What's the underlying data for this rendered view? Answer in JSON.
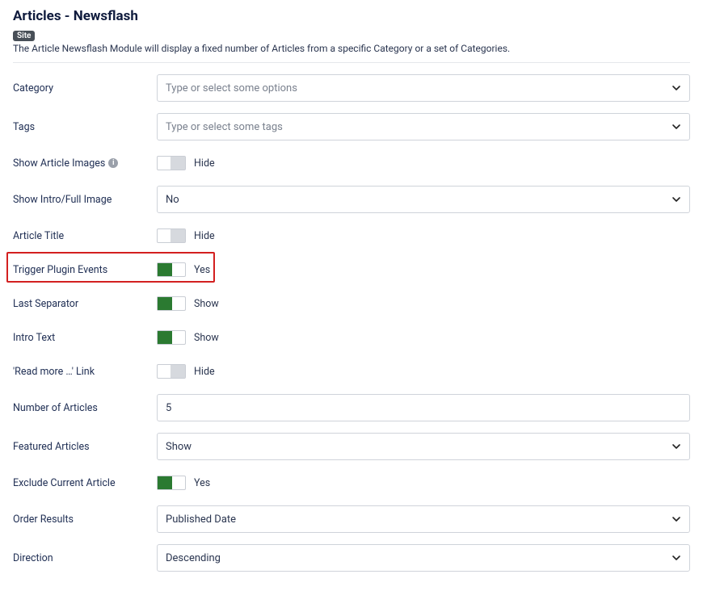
{
  "header": {
    "title": "Articles - Newsflash",
    "badge": "Site",
    "description": "The Article Newsflash Module will display a fixed number of Articles from a specific Category or a set of Categories."
  },
  "fields": {
    "category": {
      "label": "Category",
      "placeholder": "Type or select some options"
    },
    "tags": {
      "label": "Tags",
      "placeholder": "Type or select some tags"
    },
    "show_article_images": {
      "label": "Show Article Images",
      "value": "Hide",
      "on": false
    },
    "show_intro_full_image": {
      "label": "Show Intro/Full Image",
      "value": "No"
    },
    "article_title": {
      "label": "Article Title",
      "value": "Hide",
      "on": false
    },
    "trigger_plugin_events": {
      "label": "Trigger Plugin Events",
      "value": "Yes",
      "on": true
    },
    "last_separator": {
      "label": "Last Separator",
      "value": "Show",
      "on": true
    },
    "intro_text": {
      "label": "Intro Text",
      "value": "Show",
      "on": true
    },
    "read_more_link": {
      "label": "'Read more …' Link",
      "value": "Hide",
      "on": false
    },
    "number_of_articles": {
      "label": "Number of Articles",
      "value": "5"
    },
    "featured_articles": {
      "label": "Featured Articles",
      "value": "Show"
    },
    "exclude_current_article": {
      "label": "Exclude Current Article",
      "value": "Yes",
      "on": true
    },
    "order_results": {
      "label": "Order Results",
      "value": "Published Date"
    },
    "direction": {
      "label": "Direction",
      "value": "Descending"
    }
  }
}
